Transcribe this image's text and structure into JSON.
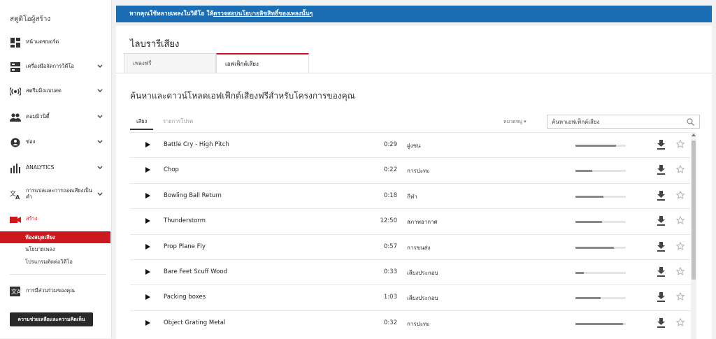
{
  "sidebar": {
    "title": "สตูดิโอผู้สร้าง",
    "items": [
      {
        "label": "หน้าแดชบอร์ด",
        "icon": "dashboard-icon",
        "chevron": false
      },
      {
        "label": "เครื่องมือจัดการวิดีโอ",
        "icon": "video-manager-icon",
        "chevron": true
      },
      {
        "label": "สตรีมมิงแบบสด",
        "icon": "live-streaming-icon",
        "chevron": true
      },
      {
        "label": "คอมมิวนิตี้",
        "icon": "community-icon",
        "chevron": true
      },
      {
        "label": "ช่อง",
        "icon": "channel-icon",
        "chevron": true
      },
      {
        "label": "ANALYTICS",
        "icon": "analytics-icon",
        "chevron": true
      },
      {
        "label": "การแปลและการถอดเสียงเป็นคำ",
        "icon": "translate-icon",
        "chevron": true
      },
      {
        "label": "สร้าง",
        "icon": "create-camera-icon",
        "chevron": false
      }
    ],
    "create_sub": [
      "ห้องสมุดเสียง",
      "นโยบายเพลง",
      "โปรแกรมตัดต่อวิดีโอ"
    ],
    "contributions": "การมีส่วนร่วมของคุณ",
    "help_button": "ความช่วยเหลือและความคิดเห็น"
  },
  "banner": {
    "text": "หากคุณใช้หลายเพลงในวิดีโอ ให้",
    "link": "ตรวจสอบนโยบายลิขสิทธิ์ของเพลงนั้นๆ"
  },
  "page": {
    "title": "ไลบรารีเสียง",
    "tabs": [
      "เพลงฟรี",
      "เอฟเฟ็กต์เสียง"
    ],
    "subtitle": "ค้นหาและดาวน์โหลดเอฟเฟ็กต์เสียงฟรีสำหรับโครงการของคุณ"
  },
  "filters": {
    "sound_tab": "เสียง",
    "favorites_tab": "รายการโปรด",
    "category_dropdown": "หมวดหมู่ ▾",
    "search_placeholder": "ค้นหาเอฟเฟ็กต์เสียง"
  },
  "tracks": [
    {
      "name": "Battle Cry - High Pitch",
      "duration": "0:29",
      "category": "ฝูงชน",
      "volume": 0.8
    },
    {
      "name": "Chop",
      "duration": "0:22",
      "category": "การปะทะ",
      "volume": 0.33
    },
    {
      "name": "Bowling Ball Return",
      "duration": "0:18",
      "category": "กีฬา",
      "volume": 0.55
    },
    {
      "name": "Thunderstorm",
      "duration": "12:50",
      "category": "สภาพอากาศ",
      "volume": 0.53
    },
    {
      "name": "Prop Plane Fly",
      "duration": "0:57",
      "category": "การขนส่ง",
      "volume": 0.76
    },
    {
      "name": "Bare Feet Scuff Wood",
      "duration": "0:33",
      "category": "เสียงประกอบ",
      "volume": 0.17
    },
    {
      "name": "Packing boxes",
      "duration": "1:03",
      "category": "เสียงประกอบ",
      "volume": 0.5
    },
    {
      "name": "Object Grating Metal",
      "duration": "0:32",
      "category": "การปะทะ",
      "volume": 0.95
    }
  ],
  "colors": {
    "accent": "#cc181e",
    "banner": "#1c6eb4",
    "help_button": "#2a2a2a"
  }
}
